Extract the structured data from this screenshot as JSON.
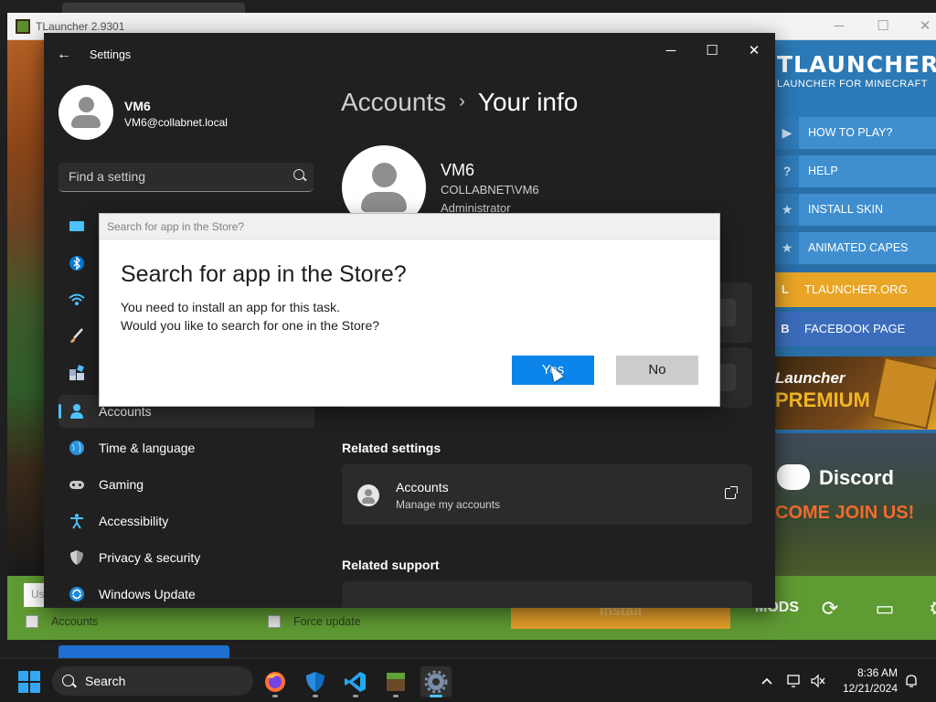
{
  "tlauncher": {
    "title": "TLauncher 2.9301",
    "brand": "TLAUNCHER",
    "tagline": "LAUNCHER FOR MINECRAFT",
    "menu": [
      {
        "icon": "play",
        "label": "HOW TO PLAY?"
      },
      {
        "icon": "?",
        "label": "HELP"
      },
      {
        "icon": "star",
        "label": "INSTALL SKIN"
      },
      {
        "icon": "star",
        "label": "ANIMATED CAPES"
      }
    ],
    "links": [
      {
        "label": "TLAUNCHER.ORG",
        "color": "#e8a526"
      },
      {
        "label": "FACEBOOK PAGE",
        "color": "#3b6dbc"
      }
    ],
    "premium_line1": "Launcher",
    "premium_line2": "PREMIUM",
    "discord_name": "Discord",
    "discord_join": "COME JOIN US!",
    "username_partial": "Us",
    "accounts_check_label": "Accounts",
    "force_update_label": "Force update",
    "install_label": "Install",
    "mods_logo": "L MODS"
  },
  "settings": {
    "window_title": "Settings",
    "user": {
      "name": "VM6",
      "email": "VM6@collabnet.local"
    },
    "search_placeholder": "Find a setting",
    "nav": [
      {
        "icon": "system-icon",
        "label": "",
        "color": "#4cc2ff"
      },
      {
        "icon": "bluetooth-icon",
        "label": "",
        "color": "#0078d4"
      },
      {
        "icon": "wifi-icon",
        "label": "",
        "color": "#4cc2ff"
      },
      {
        "icon": "brush-icon",
        "label": "",
        "color": "#e8a060"
      },
      {
        "icon": "apps-icon",
        "label": "",
        "color": "#9ab0d0"
      },
      {
        "icon": "person-icon",
        "label": "Accounts",
        "color": "#4cc2ff",
        "active": true
      },
      {
        "icon": "globe-icon",
        "label": "Time & language",
        "color": "#4cc2ff"
      },
      {
        "icon": "gamepad-icon",
        "label": "Gaming",
        "color": "#c8c8c8"
      },
      {
        "icon": "accessibility-icon",
        "label": "Accessibility",
        "color": "#4cc2ff"
      },
      {
        "icon": "shield-icon",
        "label": "Privacy & security",
        "color": "#9a9a9a"
      },
      {
        "icon": "update-icon",
        "label": "Windows Update",
        "color": "#4cc2ff"
      }
    ],
    "breadcrumb": {
      "parent": "Accounts",
      "separator": "›",
      "current": "Your info"
    },
    "info": {
      "name": "VM6",
      "domain": "COLLABNET\\VM6",
      "role": "Administrator"
    },
    "related_settings_title": "Related settings",
    "related_accounts": {
      "title": "Accounts",
      "subtitle": "Manage my accounts"
    },
    "related_support_title": "Related support"
  },
  "dialog": {
    "caption": "Search for app in the Store?",
    "heading": "Search for app in the Store?",
    "line1": "You need to install an app for this task.",
    "line2": "Would you like to search for one in the Store?",
    "yes_label": "Yes",
    "no_label": "No"
  },
  "taskbar": {
    "search_label": "Search",
    "apps": [
      "firefox-icon",
      "defender-icon",
      "vscode-icon",
      "minecraft-icon",
      "settings-icon"
    ],
    "time": "8:36 AM",
    "date": "12/21/2024"
  }
}
